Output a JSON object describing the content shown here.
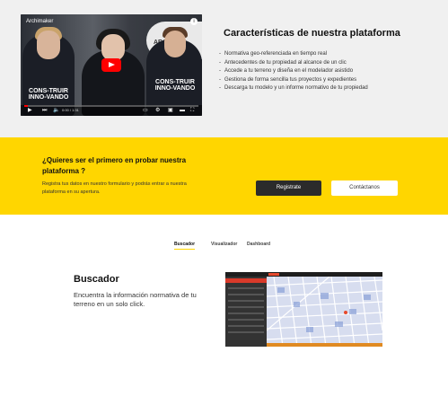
{
  "video": {
    "title": "Archimaker",
    "info_icon": "info-icon",
    "shirt_text_left": "CONS-TRUIR INNO-VANDO",
    "shirt_text_right": "CONS-TRUIR INNO-VANDO",
    "panel_text": "ARCHI",
    "progress_fraction": 0.02,
    "time": "0:00 / 1:31",
    "controls": [
      "play-icon",
      "next-icon",
      "volume-icon",
      "captions-icon",
      "settings-icon",
      "miniplayer-icon",
      "theater-icon",
      "fullscreen-icon"
    ]
  },
  "features": {
    "title": "Características de nuestra plataforma",
    "items": [
      "Normativa geo-referenciada en tiempo real",
      "Antecedentes de tu propiedad al alcance de un clic",
      "Accede a tu terreno y diseña en el modelador asistido",
      "Gestiona de forma sencilla tus proyectos y expedientes",
      "Descarga tu modelo y un informe normativo de tu propiedad"
    ]
  },
  "cta": {
    "title": "¿Quieres ser el primero en probar nuestra plataforma ?",
    "text": "Registra tus datos en nuestro formulario y podrás entrar a nuestra plataforma en su apertura.",
    "register_label": "Registrate",
    "contact_label": "Contáctanos",
    "accent": "#ffd600"
  },
  "tabs": {
    "buscador": "Buscador",
    "visualizador": "Visualizador",
    "dashboard": "Dashboard",
    "active": "Buscador"
  },
  "section": {
    "title": "Buscador",
    "description": "Encuentra la información normativa de tu terreno en un solo click."
  }
}
